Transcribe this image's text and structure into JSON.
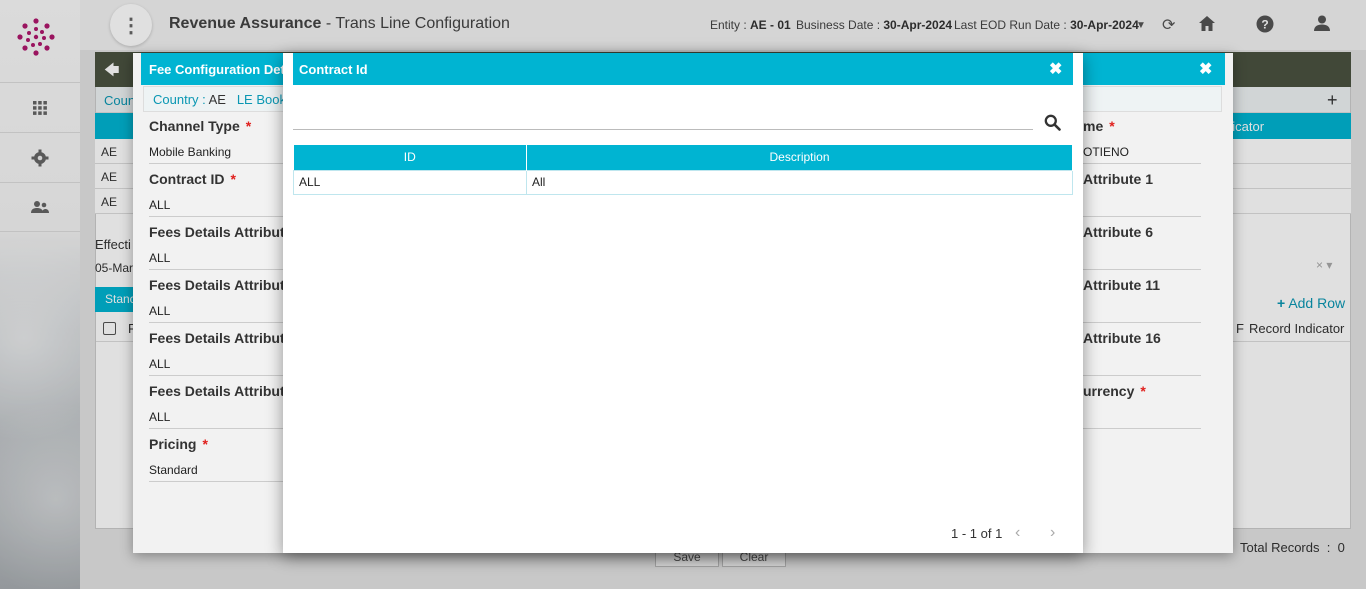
{
  "header": {
    "title_main": "Revenue Assurance",
    "title_sep": " - ",
    "title_sub": "Trans Line Configuration",
    "entity_label": "Entity : ",
    "entity_value": "AE - 01",
    "business_date_label": "Business Date : ",
    "business_date_value": "30-Apr-2024",
    "eod_label": "Last EOD Run Date : ",
    "eod_value": "30-Apr-2024"
  },
  "background": {
    "crumb": "Coun",
    "rows": [
      "AE",
      "AE",
      "AE"
    ],
    "header_right": "dicator",
    "effective": "Effecti",
    "date": "05-Mar",
    "standard_tab": "Stanc",
    "add_row": "Add Row",
    "subhead_left": "F",
    "subhead_right_f": "F",
    "record_indicator": "Record Indicator",
    "total_records_label": "Total Records",
    "total_records_sep": ":",
    "total_records_value": "0",
    "save": "Save",
    "clear": "Clear"
  },
  "fee_modal": {
    "title": "Fee Configuration Deta",
    "crumb_country_label": "Country : ",
    "crumb_country_value": "AE",
    "crumb_le_label": "LE Book :",
    "left_fields": [
      {
        "label": "Channel Type",
        "required": true,
        "value": "Mobile Banking"
      },
      {
        "label": "Contract ID",
        "required": true,
        "value": "ALL"
      },
      {
        "label": "Fees Details Attribute",
        "required": false,
        "value": "ALL"
      },
      {
        "label": "Fees Details Attribute",
        "required": false,
        "value": "ALL"
      },
      {
        "label": "Fees Details Attribute",
        "required": false,
        "value": "ALL"
      },
      {
        "label": "Fees Details Attribute",
        "required": false,
        "value": "ALL"
      },
      {
        "label": "Pricing",
        "required": true,
        "value": "Standard"
      }
    ],
    "right_fields": [
      {
        "label": "me",
        "required": true,
        "value": "OTIENO"
      },
      {
        "label": "Attribute 1",
        "required": false,
        "value": ""
      },
      {
        "label": "Attribute 6",
        "required": false,
        "value": ""
      },
      {
        "label": "Attribute 11",
        "required": false,
        "value": ""
      },
      {
        "label": "Attribute 16",
        "required": false,
        "value": ""
      },
      {
        "label": "urrency",
        "required": true,
        "value": ""
      }
    ]
  },
  "contract_modal": {
    "title": "Contract Id",
    "search_placeholder": "",
    "columns": [
      "ID",
      "Description"
    ],
    "rows": [
      {
        "id": "ALL",
        "description": "All"
      }
    ],
    "pager_text": "1 - 1 of 1"
  }
}
